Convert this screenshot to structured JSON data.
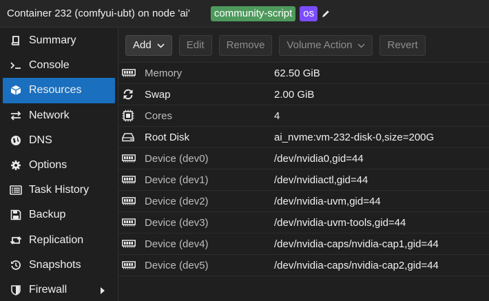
{
  "header": {
    "title": "Container 232 (comfyui-ubt) on node 'ai'",
    "tags": [
      "community-script",
      "os"
    ]
  },
  "sidebar": {
    "items": [
      {
        "label": "Summary",
        "icon": "book-icon"
      },
      {
        "label": "Console",
        "icon": "terminal-icon"
      },
      {
        "label": "Resources",
        "icon": "cube-icon",
        "active": true
      },
      {
        "label": "Network",
        "icon": "exchange-icon"
      },
      {
        "label": "DNS",
        "icon": "globe-icon"
      },
      {
        "label": "Options",
        "icon": "gear-icon"
      },
      {
        "label": "Task History",
        "icon": "list-icon"
      },
      {
        "label": "Backup",
        "icon": "floppy-icon"
      },
      {
        "label": "Replication",
        "icon": "retweet-icon"
      },
      {
        "label": "Snapshots",
        "icon": "history-icon"
      },
      {
        "label": "Firewall",
        "icon": "shield-icon"
      }
    ]
  },
  "toolbar": {
    "add": "Add",
    "edit": "Edit",
    "remove": "Remove",
    "volume_action": "Volume Action",
    "revert": "Revert"
  },
  "resources": {
    "rows": [
      {
        "key": "Memory",
        "value": "62.50 GiB",
        "icon": "memory-icon",
        "dim": true
      },
      {
        "key": "Swap",
        "value": "2.00 GiB",
        "icon": "refresh-icon",
        "dim": false
      },
      {
        "key": "Cores",
        "value": "4",
        "icon": "cpu-icon",
        "dim": true
      },
      {
        "key": "Root Disk",
        "value": "ai_nvme:vm-232-disk-0,size=200G",
        "icon": "hdd-icon",
        "dim": false
      },
      {
        "key": "Device (dev0)",
        "value": "/dev/nvidia0,gid=44",
        "icon": "device-icon",
        "dim": true
      },
      {
        "key": "Device (dev1)",
        "value": "/dev/nvidiactl,gid=44",
        "icon": "device-icon",
        "dim": true
      },
      {
        "key": "Device (dev2)",
        "value": "/dev/nvidia-uvm,gid=44",
        "icon": "device-icon",
        "dim": true
      },
      {
        "key": "Device (dev3)",
        "value": "/dev/nvidia-uvm-tools,gid=44",
        "icon": "device-icon",
        "dim": true
      },
      {
        "key": "Device (dev4)",
        "value": "/dev/nvidia-caps/nvidia-cap1,gid=44",
        "icon": "device-icon",
        "dim": true
      },
      {
        "key": "Device (dev5)",
        "value": "/dev/nvidia-caps/nvidia-cap2,gid=44",
        "icon": "device-icon",
        "dim": true
      }
    ]
  },
  "colors": {
    "active_nav": "#1a6fbf",
    "tag_community": "#4e9a5c",
    "tag_os": "#7c4dff"
  }
}
